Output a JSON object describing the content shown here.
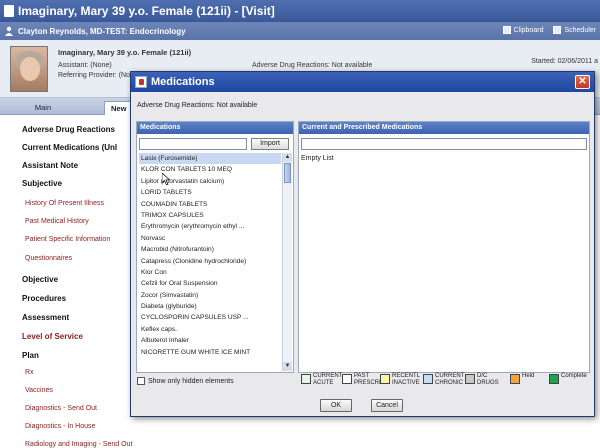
{
  "app": {
    "title": "Imaginary, Mary 39 y.o. Female (121ii) - [Visit]",
    "user_bar": "Clayton Reynolds, MD-TEST: Endocrinology",
    "clipboard": "Clipboard",
    "scheduler": "Scheduler"
  },
  "patient": {
    "name": "Imaginary, Mary 39 y.o. Female (121ii)",
    "assistant": "Assistant: (None)",
    "referring": "Referring Provider: (Nor",
    "adr": "Adverse Drug Reactions: Not available",
    "started": "Started: 02/06/2011 a"
  },
  "tabs": {
    "main": "Main",
    "new": "New"
  },
  "sidebar": {
    "items": [
      {
        "label": "Adverse Drug Reactions",
        "kind": "h"
      },
      {
        "label": "Current Medications (Unl",
        "kind": "h"
      },
      {
        "label": "Assistant Note",
        "kind": "h"
      },
      {
        "label": "Subjective",
        "kind": "h"
      },
      {
        "label": "History Of Present Illness",
        "kind": "sub"
      },
      {
        "label": "Past Medical History",
        "kind": "sub"
      },
      {
        "label": "Patient Specific Information",
        "kind": "sub"
      },
      {
        "label": "Questionnaires",
        "kind": "sub"
      },
      {
        "label": "Objective",
        "kind": "h"
      },
      {
        "label": "Procedures",
        "kind": "h"
      },
      {
        "label": "Assessment",
        "kind": "h"
      },
      {
        "label": "Level of Service",
        "kind": "h-red"
      },
      {
        "label": "Plan",
        "kind": "h"
      },
      {
        "label": "Rx",
        "kind": "sub"
      },
      {
        "label": "Vaccines",
        "kind": "sub"
      },
      {
        "label": "Diagnostics - Send Out",
        "kind": "sub"
      },
      {
        "label": "Diagnostics - In House",
        "kind": "sub"
      },
      {
        "label": "Radiology and Imaging - Send Out",
        "kind": "sub"
      }
    ]
  },
  "dialog": {
    "title": "Medications",
    "close": "✕",
    "adr_note": "Adverse Drug Reactions: Not available",
    "left_header": "Medications",
    "right_header": "Current and Prescribed Medications",
    "import_label": "Import",
    "search_value": "",
    "empty_list": "Empty List",
    "show_hidden": "Show only hidden elements",
    "ok": "OK",
    "cancel": "Cancel",
    "medications": [
      "Lasix (Furosemide)",
      "KLOR CON TABLETS 10 MEQ",
      "Lipitor (Atorvastatin calcium)",
      "LORID TABLETS",
      "COUMADIN TABLETS",
      "TRIMOX CAPSULES",
      "Erythromycin (erythromycin ethyl ...",
      "Norvasc",
      "Macrobid (Nitrofurantoin)",
      "Catapress (Clonidine hydrochloride)",
      "Klor Con",
      "Cefzil for Oral Suspension",
      "Zocor (Simvastatin)",
      "Diabeta (glyburide)",
      "CYCLOSPORIN CAPSULES USP ...",
      "Keflex caps.",
      "Albuterol Inhaler",
      "NICORETTE GUM WHITE ICE MINT"
    ],
    "legend": [
      {
        "label1": "CURRENT",
        "label2": "ACUTE",
        "color": "#e6f5ea"
      },
      {
        "label1": "PAST",
        "label2": "PRESCRIE",
        "color": "#ffffff"
      },
      {
        "label1": "RECENTL",
        "label2": "INACTIVE",
        "color": "#fdf5a6"
      },
      {
        "label1": "CURRENT",
        "label2": "CHRONIC",
        "color": "#c6dcf6"
      },
      {
        "label1": "D/C",
        "label2": "DRUGS",
        "color": "#c8c8c8"
      },
      {
        "label1": "Held",
        "label2": "",
        "color": "#f4a43c"
      },
      {
        "label1": "Complete",
        "label2": "",
        "color": "#1da34a"
      }
    ]
  }
}
